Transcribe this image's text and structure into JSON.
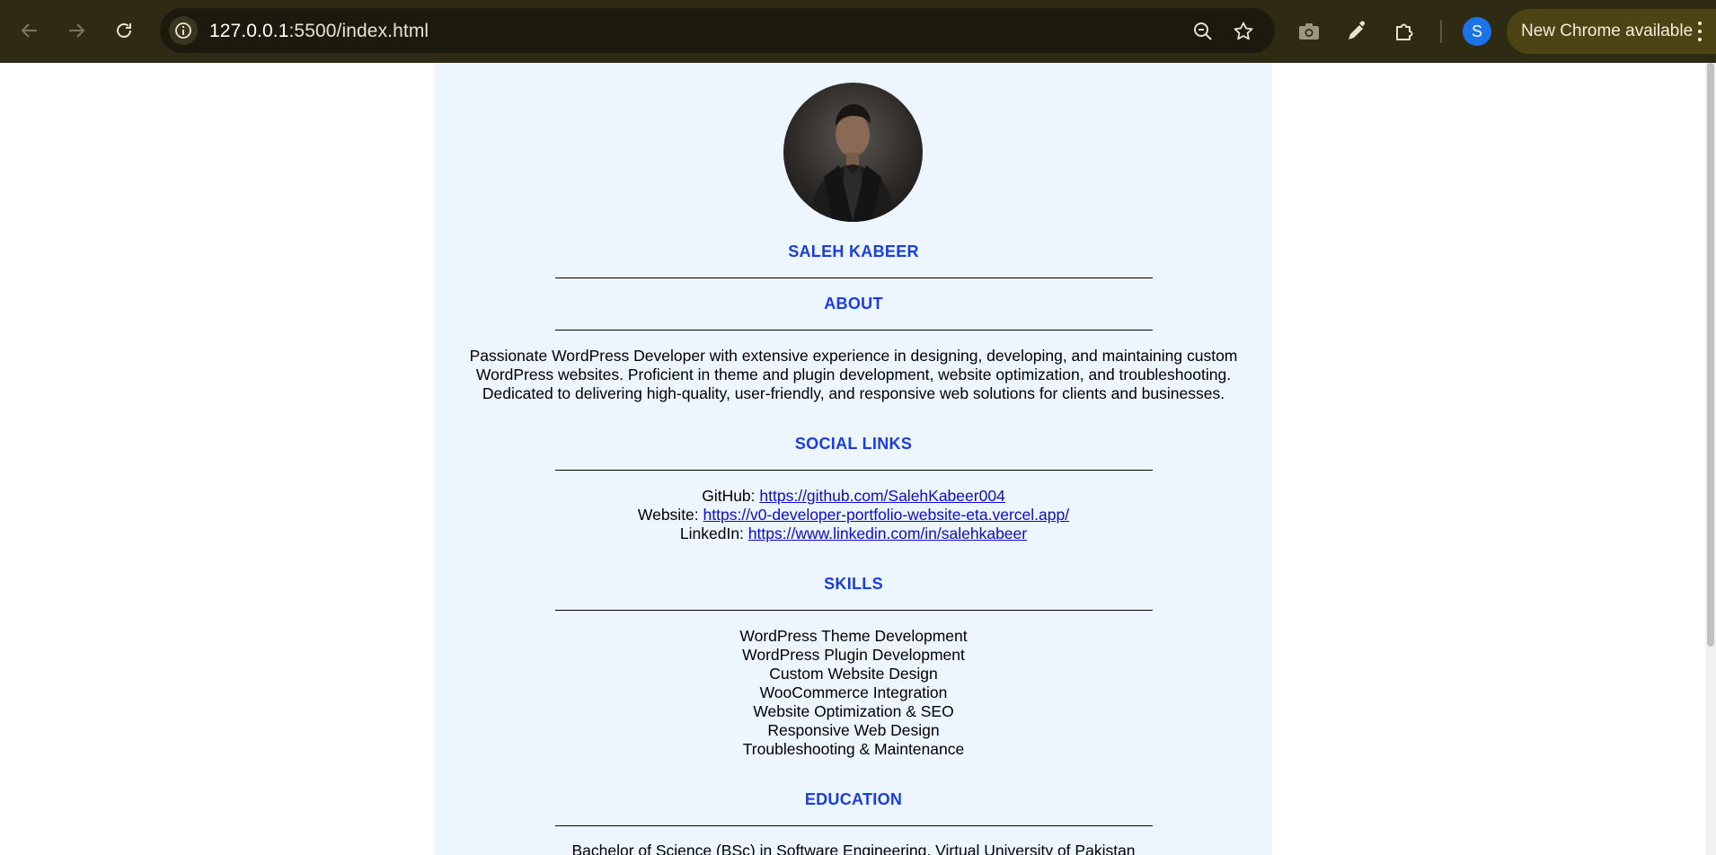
{
  "browser": {
    "url_host": "127.0.0.1",
    "url_rest": ":5500/index.html",
    "profile_initial": "S",
    "update_label": "New Chrome available"
  },
  "resume": {
    "name": "SALEH KABEER",
    "about": {
      "heading": "ABOUT",
      "lines": [
        "Passionate WordPress Developer with extensive experience in designing, developing, and maintaining custom",
        "WordPress websites. Proficient in theme and plugin development, website optimization, and troubleshooting.",
        "Dedicated to delivering high-quality, user-friendly, and responsive web solutions for clients and businesses."
      ]
    },
    "social": {
      "heading": "SOCIAL LINKS",
      "links": [
        {
          "label": "GitHub:",
          "url": "https://github.com/SalehKabeer004"
        },
        {
          "label": "Website:",
          "url": "https://v0-developer-portfolio-website-eta.vercel.app/"
        },
        {
          "label": "LinkedIn:",
          "url": "https://www.linkedin.com/in/salehkabeer"
        }
      ]
    },
    "skills": {
      "heading": "SKILLS",
      "items": [
        "WordPress Theme Development",
        "WordPress Plugin Development",
        "Custom Website Design",
        "WooCommerce Integration",
        "Website Optimization & SEO",
        "Responsive Web Design",
        "Troubleshooting & Maintenance"
      ]
    },
    "education": {
      "heading": "EDUCATION",
      "line": "Bachelor of Science (BSc) in Software Engineering, Virtual University of Pakistan"
    }
  }
}
